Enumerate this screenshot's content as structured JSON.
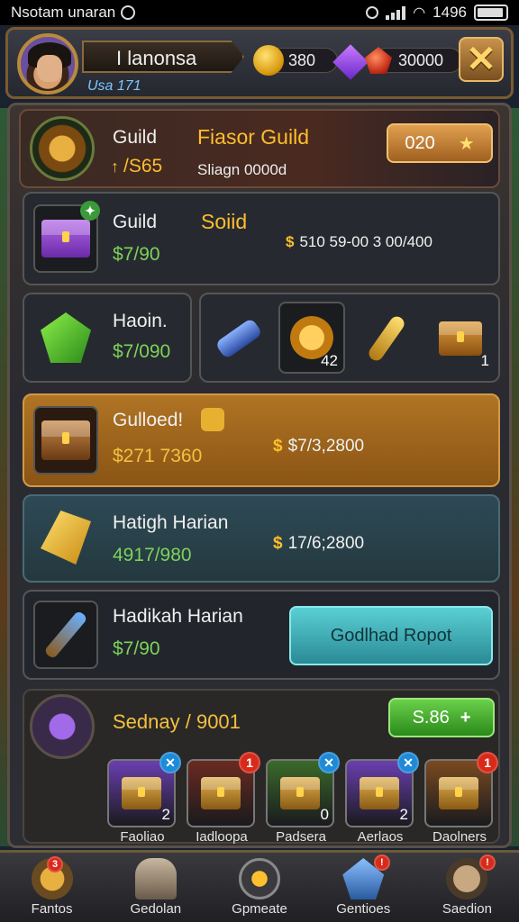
{
  "status_bar": {
    "carrier": "Nsotam unaran",
    "time": "1496"
  },
  "header": {
    "player_name": "I lanonsa",
    "level_text": "Usa 171",
    "coins": "380",
    "rubies": "30000"
  },
  "guild_card": {
    "label": "Guild",
    "name": "Fiasor Guild",
    "sub_value": "/S65",
    "sub_detail": "Sliagn 0000d",
    "button": "020"
  },
  "offer_1": {
    "label": "Guild",
    "tag": "Soiid",
    "price": "$7/90",
    "total": "510 59-00 3 00/400"
  },
  "offer_2": {
    "label": "Haoin.",
    "price": "$7/090",
    "items": [
      {
        "name": "scroll",
        "count": ""
      },
      {
        "name": "sun-medal",
        "count": "42"
      },
      {
        "name": "golden-key",
        "count": ""
      },
      {
        "name": "chest",
        "count": "1"
      }
    ]
  },
  "offer_3": {
    "label": "Gulloed!",
    "price": "$271 7360",
    "total": "$7/3,2800"
  },
  "offer_4": {
    "label": "Hatigh Harian",
    "price": "4917/980",
    "total": "17/6;2800"
  },
  "offer_5": {
    "label": "Hadikah Harian",
    "price": "$7/90",
    "button": "Godlhad Ropot"
  },
  "bundle": {
    "title": "Sednay / 9001",
    "button": "S.86",
    "items": [
      {
        "label": "Faoliao",
        "count": "2",
        "color": "#6a3fb0"
      },
      {
        "label": "Iadloopa",
        "count": "",
        "color": "#6a2a20"
      },
      {
        "label": "Padsera",
        "count": "0",
        "color": "#3a6a2a"
      },
      {
        "label": "Aerlaos",
        "count": "2",
        "color": "#6a3fb0"
      },
      {
        "label": "Daolners",
        "count": "",
        "color": "#7a4a20"
      }
    ]
  },
  "nav": [
    {
      "label": "Fantos",
      "badge": "3"
    },
    {
      "label": "Gedolan",
      "badge": ""
    },
    {
      "label": "Gpmeate",
      "badge": ""
    },
    {
      "label": "Gentioes",
      "badge": ""
    },
    {
      "label": "Saedion",
      "badge": ""
    }
  ],
  "colors": {
    "gold": "#ffbe2c",
    "green": "#7ed25a",
    "teal": "#2aa8b0",
    "orange_card": "#a66a1a"
  }
}
